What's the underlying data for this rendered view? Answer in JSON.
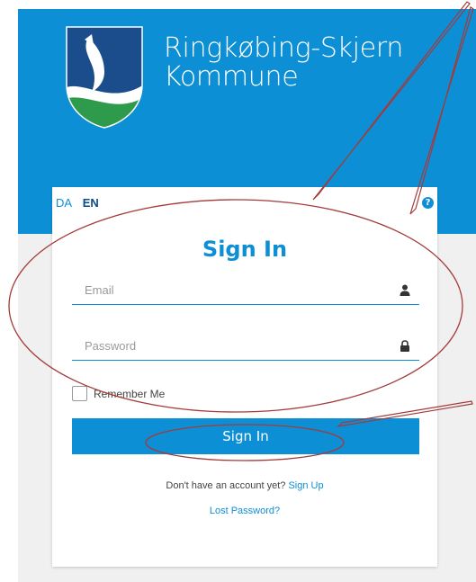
{
  "branding": {
    "line1": "Ringkøbing-Skjern",
    "line2": "Kommune",
    "colors": {
      "primary": "#0d8fd6",
      "shield_dark": "#1b4d8c",
      "shield_green": "#2e9a4b",
      "annotation": "#a33a3a"
    }
  },
  "language": {
    "options": [
      "DA",
      "EN"
    ],
    "active": "EN"
  },
  "help_icon": "question-circle-icon",
  "signin": {
    "title": "Sign In",
    "email_placeholder": "Email",
    "password_placeholder": "Password",
    "remember_label": "Remember Me",
    "remember_checked": false,
    "submit_label": "Sign In",
    "no_account_text": "Don't have an account yet?",
    "signup_link": "Sign Up",
    "lost_password_link": "Lost Password?"
  }
}
